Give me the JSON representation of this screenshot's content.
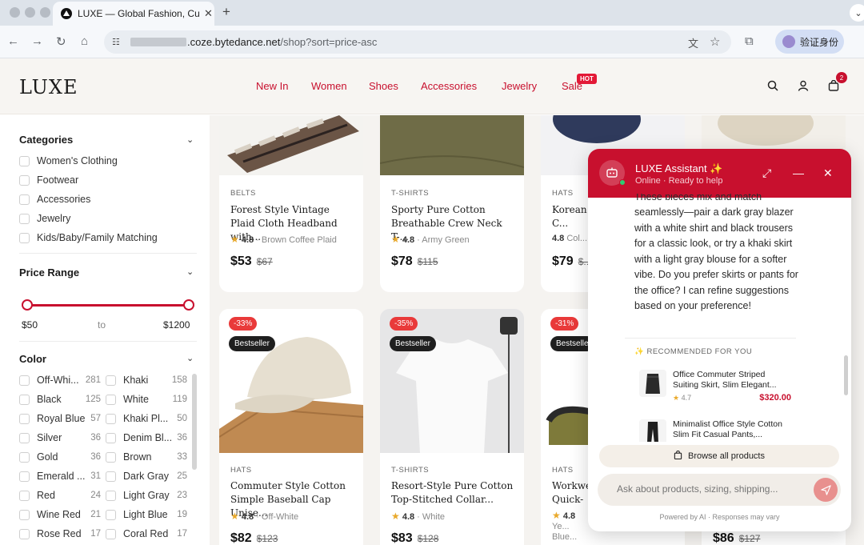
{
  "browser": {
    "tab_title": "LUXE — Global Fashion, Cura",
    "tab_close": "✕",
    "new_tab": "+",
    "url_domain": ".coze.bytedance.net",
    "url_path": "/shop?sort=price-asc",
    "verify_label": "验证身份"
  },
  "header": {
    "logo": "LUXE",
    "nav": [
      "New In",
      "Women",
      "Shoes",
      "Accessories",
      "Jewelry",
      "Sale"
    ],
    "sale_badge": "HOT",
    "cart_count": "2"
  },
  "sidebar": {
    "categories_title": "Categories",
    "categories": [
      "Women's Clothing",
      "Footwear",
      "Accessories",
      "Jewelry",
      "Kids/Baby/Family Matching"
    ],
    "price_title": "Price Range",
    "price_min": "$50",
    "price_to": "to",
    "price_max": "$1200",
    "color_title": "Color",
    "colors_left": [
      {
        "name": "Off-Whi...",
        "count": "281"
      },
      {
        "name": "Black",
        "count": "125"
      },
      {
        "name": "Royal Blue",
        "count": "57"
      },
      {
        "name": "Silver",
        "count": "36"
      },
      {
        "name": "Gold",
        "count": "36"
      },
      {
        "name": "Emerald ...",
        "count": "31"
      },
      {
        "name": "Red",
        "count": "24"
      },
      {
        "name": "Wine Red",
        "count": "21"
      },
      {
        "name": "Rose Red",
        "count": "17"
      }
    ],
    "colors_right": [
      {
        "name": "Khaki",
        "count": "158"
      },
      {
        "name": "White",
        "count": "119"
      },
      {
        "name": "Khaki Pl...",
        "count": "50"
      },
      {
        "name": "Denim Bl...",
        "count": "36"
      },
      {
        "name": "Brown",
        "count": "33"
      },
      {
        "name": "Dark Gray",
        "count": "25"
      },
      {
        "name": "Light Gray",
        "count": "23"
      },
      {
        "name": "Light Blue",
        "count": "19"
      },
      {
        "name": "Coral Red",
        "count": "17"
      }
    ]
  },
  "products_row1": [
    {
      "category": "BELTS",
      "name": "Forest Style Vintage Plaid Cloth Headband with...",
      "rating": "4.8",
      "color": "Brown Coffee Plaid",
      "price": "$53",
      "old_price": "$67"
    },
    {
      "category": "T-SHIRTS",
      "name": "Sporty Pure Cotton Breathable Crew Neck T-...",
      "rating": "4.8",
      "color": "Army Green",
      "price": "$78",
      "old_price": "$115"
    },
    {
      "category": "HATS",
      "name": "Korean C... Breathab...",
      "rating": "4.8",
      "color": "Col... (Red...",
      "price": "$79",
      "old_price": "$..."
    }
  ],
  "products_row2": [
    {
      "discount": "-33%",
      "badge": "Bestseller",
      "category": "HATS",
      "name": "Commuter Style Cotton Simple Baseball Cap Unise...",
      "rating": "4.8",
      "color": "Off-White",
      "price": "$82",
      "old_price": "$123"
    },
    {
      "discount": "-35%",
      "badge": "Bestseller",
      "category": "T-SHIRTS",
      "name": "Resort-Style Pure Cotton Top-Stitched Collar...",
      "rating": "4.8",
      "color": "White",
      "price": "$83",
      "old_price": "$128"
    },
    {
      "discount": "-31%",
      "badge": "Bestselle",
      "category": "HATS",
      "name": "Workwe... Quick-D...",
      "rating": "4.8",
      "color": "Ye... Blue...",
      "price": "",
      "old_price": ""
    }
  ],
  "product_fourth_price": "$86",
  "product_fourth_old": "$127",
  "chat": {
    "title": "LUXE Assistant",
    "status": "Online · Ready to help",
    "message_cut": "These pieces mix and match",
    "message": "seamlessly—pair a dark gray blazer with a white shirt and black trousers for a classic look, or try a khaki skirt with a light gray blouse for a softer vibe. Do you prefer skirts or pants for the office? I can refine suggestions based on your preference!",
    "recommended_label": "RECOMMENDED FOR YOU",
    "recommendations": [
      {
        "title": "Office Commuter Striped Suiting Skirt, Slim Elegant...",
        "rating": "4.7",
        "price": "$320.00"
      },
      {
        "title": "Minimalist Office Style Cotton Slim Fit Casual Pants,...",
        "rating": "",
        "price": ""
      }
    ],
    "browse_label": "Browse all products",
    "input_placeholder": "Ask about products, sizing, shipping...",
    "powered": "Powered by AI · Responses may vary"
  },
  "colors": {
    "accent": "#c8102e",
    "discount": "#e93a3a",
    "bg": "#f5f3f0"
  }
}
